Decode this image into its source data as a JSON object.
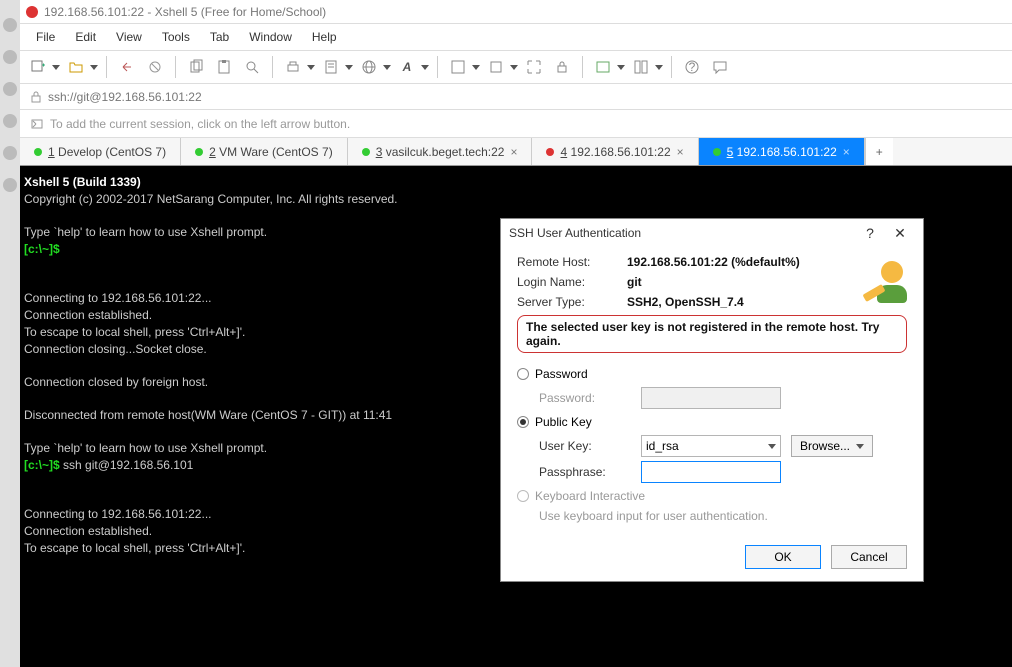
{
  "window": {
    "title": "192.168.56.101:22 - Xshell 5 (Free for Home/School)"
  },
  "menu": {
    "items": [
      "File",
      "Edit",
      "View",
      "Tools",
      "Tab",
      "Window",
      "Help"
    ]
  },
  "address": {
    "url": "ssh://git@192.168.56.101:22"
  },
  "info": {
    "hint": "To add the current session, click on the left arrow button."
  },
  "tabs": {
    "items": [
      {
        "num": "1",
        "label": "Develop (CentOS 7)",
        "color": "green"
      },
      {
        "num": "2",
        "label": "VM Ware  (CentOS 7)",
        "color": "green"
      },
      {
        "num": "3",
        "label": "vasilcuk.beget.tech:22",
        "color": "green"
      },
      {
        "num": "4",
        "label": "192.168.56.101:22",
        "color": "red"
      },
      {
        "num": "5",
        "label": "192.168.56.101:22",
        "color": "green",
        "active": true
      }
    ]
  },
  "terminal": {
    "l1": "Xshell 5 (Build 1339)",
    "l2": "Copyright (c) 2002-2017 NetSarang Computer, Inc. All rights reserved.",
    "l3": "Type `help' to learn how to use Xshell prompt.",
    "p1": "[c:\\~]$",
    "l4": "Connecting to 192.168.56.101:22...",
    "l5": "Connection established.",
    "l6": "To escape to local shell, press 'Ctrl+Alt+]'.",
    "l7": "Connection closing...Socket close.",
    "l8": "Connection closed by foreign host.",
    "l9": "Disconnected from remote host(WM Ware (CentOS 7 - GIT)) at 11:41",
    "l10": "Type `help' to learn how to use Xshell prompt.",
    "p2": "[c:\\~]$ ",
    "cmd": "ssh git@192.168.56.101",
    "l11": "Connecting to 192.168.56.101:22...",
    "l12": "Connection established.",
    "l13": "To escape to local shell, press 'Ctrl+Alt+]'."
  },
  "dialog": {
    "title": "SSH User Authentication",
    "remote_host_label": "Remote Host:",
    "remote_host": "192.168.56.101:22 (%default%)",
    "login_name_label": "Login Name:",
    "login_name": "git",
    "server_type_label": "Server Type:",
    "server_type": "SSH2, OpenSSH_7.4",
    "error": "The selected user key is not registered in the remote host. Try again.",
    "radio_password": "Password",
    "field_password": "Password:",
    "radio_publickey": "Public Key",
    "field_userkey": "User Key:",
    "userkey_value": "id_rsa",
    "browse": "Browse...",
    "field_passphrase": "Passphrase:",
    "passphrase_value": "",
    "radio_kbd": "Keyboard Interactive",
    "kbd_sub": "Use keyboard input for user authentication.",
    "ok": "OK",
    "cancel": "Cancel"
  }
}
